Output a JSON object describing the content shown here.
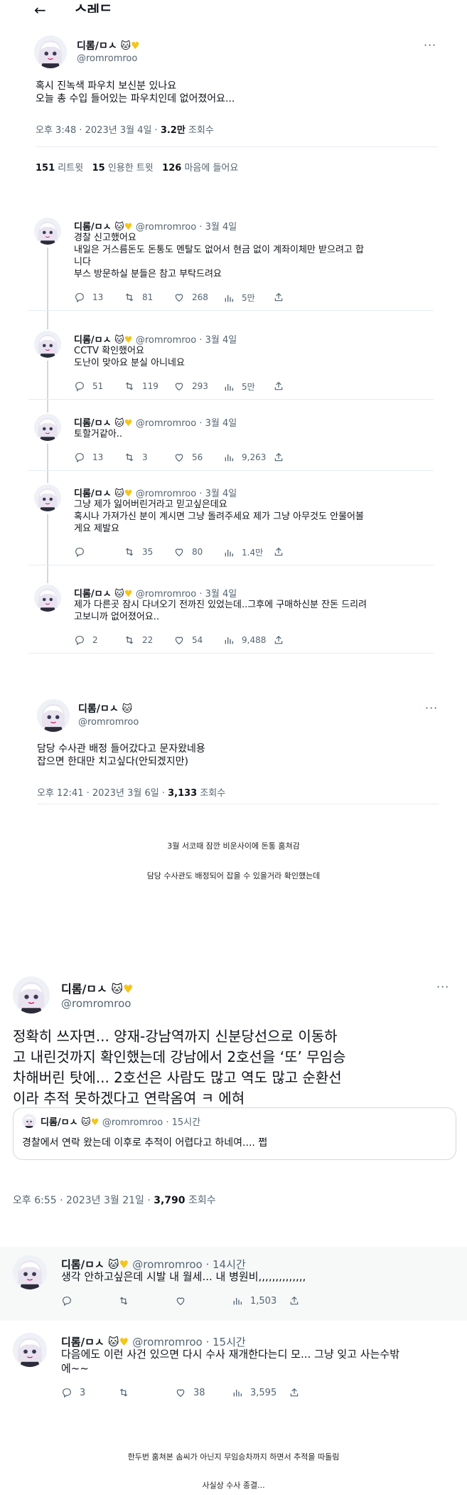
{
  "header": {
    "back_icon": "arrow-left-icon",
    "title": "스레드"
  },
  "user": {
    "name": "디롬/ㅁㅅ",
    "handle": "@romromroo",
    "name_emoji": "cat-face-icon yellow-heart-icon"
  },
  "post1": {
    "line1": "혹시 진녹색 파우치 보신분 있나요",
    "line2": "오늘 총 수입 들어있는 파우치인데 없어졌어요...",
    "time": "오후 3:48 · 2023년 3월 4일 · ",
    "views": "3.2만",
    "views_label": " 조회수",
    "retweets": "151",
    "retweets_label": "리트윗",
    "quotes": "15",
    "quotes_label": "인용한 트윗",
    "likes": "126",
    "likes_label": "마음에 들어요"
  },
  "replies": [
    {
      "meta": "@romromroo · 3월 4일",
      "lines": [
        "경찰 신고했어요",
        "내일은 거스름돈도 돈통도 멘탈도 없어서 현금 없이 계좌이체만 받으려고 합",
        "니다",
        "부스 방문하실 분들은 참고 부탁드려요"
      ],
      "reply": "13",
      "retweet": "81",
      "like": "268",
      "views": "5만"
    },
    {
      "meta": "@romromroo · 3월 4일",
      "lines": [
        "CCTV 확인했어요",
        "도난이 맞아요 분실 아니네요"
      ],
      "reply": "51",
      "retweet": "119",
      "like": "293",
      "views": "5만"
    },
    {
      "meta": "@romromroo · 3월 4일",
      "lines": [
        "토할거같아.."
      ],
      "reply": "13",
      "retweet": "3",
      "like": "56",
      "views": "9,263"
    },
    {
      "meta": "@romromroo · 3월 4일",
      "lines": [
        "그냥 제가 잃어버린거라고 믿고싶은데요",
        "혹시나 가져가신 분이 계시면 그냥 돌려주세요 제가 그냥 아무것도 안물어볼",
        "게요 제발요"
      ],
      "reply": "",
      "retweet": "35",
      "like": "80",
      "views": "1.4만"
    },
    {
      "meta": "@romromroo · 3월 4일",
      "lines": [
        "제가 다른곳 잠시 다녀오기 전까진 있었는데..그후에 구매하신분 잔돈 드리려",
        "고보니까 없어졌어요.."
      ],
      "reply": "2",
      "retweet": "22",
      "like": "54",
      "views": "9,488"
    }
  ],
  "post2": {
    "line1": "담당 수사관 배정 들어갔다고 문자왔네용",
    "line2": "잡으면 한대만 치고싶다(안되겠지만)",
    "time": "오후 12:41 · 2023년 3월 6일 · ",
    "views": "3,133",
    "views_label": " 조회수"
  },
  "caption1": "3월 서코때 잠깐 비운사이에 돈통 훔쳐감",
  "caption2": "담당 수사관도 배정되어 잡을 수 있을거라 확인했는데",
  "post3": {
    "lines": [
      "정확히 쓰자면... 양재-강남역까지 신분당선으로 이동하",
      "고 내린것까지 확인했는데 강남에서 2호선을 ‘또’ 무임승",
      "차해버린 탓에... 2호선은 사람도 많고 역도 많고 순환선",
      "이라 추적 못하겠다고 연락옴여 ㅋ 에혀"
    ],
    "quote_meta": "@romromroo · 15시간",
    "quote_text": "경찰에서 연락 왔는데 이후로 추적이 어렵다고 하네여.... 쩝",
    "time": "오후 6:55 · 2023년 3월 21일 · ",
    "views": "3,790",
    "views_label": " 조회수"
  },
  "replies2": [
    {
      "meta": "@romromroo · 14시간",
      "lines": [
        "생각 안하고싶은데 시발 내 월세... 내 병원비,,,,,,,,,,,,,,"
      ],
      "reply": "",
      "retweet": "",
      "like": "",
      "views": "1,503"
    },
    {
      "meta": "@romromroo · 15시간",
      "lines": [
        "다음에도 이런 사건 있으면 다시 수사 재개한다는디 모... 그냥 잊고 사는수밖",
        "에~~"
      ],
      "reply": "3",
      "retweet": "",
      "like": "38",
      "views": "3,595"
    }
  ],
  "caption3": "한두번 훔쳐본 솜씨가 아닌지 무임승차까지 하면서 추적을 따돌림",
  "caption4": "사실상 수사 종결...",
  "colors": {
    "accent": "#1d9bf0",
    "muted": "#536471",
    "border": "#e6ecf0",
    "heart": "#f5c518"
  }
}
